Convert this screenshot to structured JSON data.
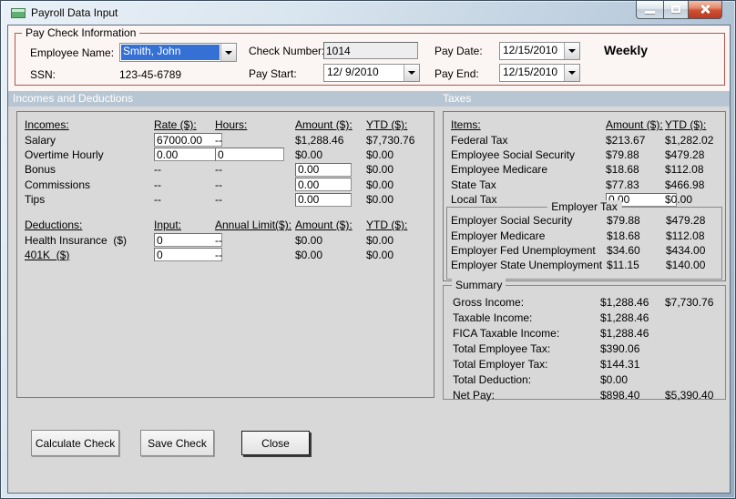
{
  "window": {
    "title": "Payroll Data Input"
  },
  "paycheck_info": {
    "group_label": "Pay Check Information",
    "employee_name_label": "Employee Name:",
    "employee_name_value": "Smith, John",
    "ssn_label": "SSN:",
    "ssn_value": "123-45-6789",
    "check_number_label": "Check Number:",
    "check_number_value": "1014",
    "pay_start_label": "Pay Start:",
    "pay_start_value": "12/ 9/2010",
    "pay_date_label": "Pay Date:",
    "pay_date_value": "12/15/2010",
    "pay_end_label": "Pay End:",
    "pay_end_value": "12/15/2010",
    "frequency": "Weekly"
  },
  "sections": {
    "incomes_header": "Incomes and Deductions",
    "taxes_header": "Taxes"
  },
  "incomes": {
    "headers": [
      "Incomes:",
      "Rate ($):",
      "Hours:",
      "Amount ($):",
      "YTD ($):"
    ],
    "rows": [
      [
        {
          "t": "text",
          "v": "Salary"
        },
        {
          "t": "input",
          "v": "67000.00",
          "w": 75,
          "n": "salary-rate-input"
        },
        {
          "t": "text",
          "v": "--"
        },
        {
          "t": "text",
          "v": "$1,288.46"
        },
        {
          "t": "text",
          "v": "$7,730.76"
        }
      ],
      [
        {
          "t": "text",
          "v": "Overtime Hourly"
        },
        {
          "t": "input",
          "v": "0.00",
          "w": 75,
          "n": "overtime-rate-input"
        },
        {
          "t": "input",
          "v": "0",
          "w": 76,
          "n": "overtime-hours-input"
        },
        {
          "t": "text",
          "v": "$0.00"
        },
        {
          "t": "text",
          "v": "$0.00"
        }
      ],
      [
        {
          "t": "text",
          "v": "Bonus"
        },
        {
          "t": "text",
          "v": "--"
        },
        {
          "t": "text",
          "v": "--"
        },
        {
          "t": "input",
          "v": "0.00",
          "w": 62,
          "n": "bonus-amount-input"
        },
        {
          "t": "text",
          "v": "$0.00"
        }
      ],
      [
        {
          "t": "text",
          "v": "Commissions"
        },
        {
          "t": "text",
          "v": "--"
        },
        {
          "t": "text",
          "v": "--"
        },
        {
          "t": "input",
          "v": "0.00",
          "w": 62,
          "n": "commissions-amount-input"
        },
        {
          "t": "text",
          "v": "$0.00"
        }
      ],
      [
        {
          "t": "text",
          "v": "Tips"
        },
        {
          "t": "text",
          "v": "--"
        },
        {
          "t": "text",
          "v": "--"
        },
        {
          "t": "input",
          "v": "0.00",
          "w": 62,
          "n": "tips-amount-input"
        },
        {
          "t": "text",
          "v": "$0.00"
        }
      ]
    ]
  },
  "deductions": {
    "headers": [
      "Deductions:",
      "Input:",
      "Annual Limit($):",
      "Amount ($):",
      "YTD ($):"
    ],
    "rows": [
      [
        {
          "t": "text",
          "v": "Health Insurance  ($)"
        },
        {
          "t": "input",
          "v": "0",
          "w": 75,
          "n": "health-insurance-input"
        },
        {
          "t": "text",
          "v": "--"
        },
        {
          "t": "text",
          "v": "$0.00"
        },
        {
          "t": "text",
          "v": "$0.00"
        }
      ],
      [
        {
          "t": "text",
          "v": "401K  ($)",
          "u": true
        },
        {
          "t": "input",
          "v": "0",
          "w": 75,
          "n": "401k-input"
        },
        {
          "t": "text",
          "v": "--"
        },
        {
          "t": "text",
          "v": "$0.00"
        },
        {
          "t": "text",
          "v": "$0.00"
        }
      ]
    ]
  },
  "taxes": {
    "headers": [
      "Items:",
      "Amount ($):",
      "YTD ($):"
    ],
    "rows": [
      [
        {
          "t": "text",
          "v": "Federal Tax"
        },
        {
          "t": "text",
          "v": "$213.67"
        },
        {
          "t": "text",
          "v": "$1,282.02"
        }
      ],
      [
        {
          "t": "text",
          "v": "Employee Social Security"
        },
        {
          "t": "text",
          "v": "$79.88"
        },
        {
          "t": "text",
          "v": "$479.28"
        }
      ],
      [
        {
          "t": "text",
          "v": "Employee Medicare"
        },
        {
          "t": "text",
          "v": "$18.68"
        },
        {
          "t": "text",
          "v": "$112.08"
        }
      ],
      [
        {
          "t": "text",
          "v": "State Tax"
        },
        {
          "t": "text",
          "v": "$77.83"
        },
        {
          "t": "text",
          "v": "$466.98"
        }
      ],
      [
        {
          "t": "text",
          "v": "Local Tax"
        },
        {
          "t": "input",
          "v": "0.00",
          "w": 78,
          "n": "local-tax-input"
        },
        {
          "t": "text",
          "v": "$0.00"
        }
      ]
    ],
    "employer_group_label": "Employer Tax",
    "employer_rows": [
      [
        {
          "t": "text",
          "v": "Employer Social Security"
        },
        {
          "t": "text",
          "v": "$79.88"
        },
        {
          "t": "text",
          "v": "$479.28"
        }
      ],
      [
        {
          "t": "text",
          "v": "Employer Medicare"
        },
        {
          "t": "text",
          "v": "$18.68"
        },
        {
          "t": "text",
          "v": "$112.08"
        }
      ],
      [
        {
          "t": "text",
          "v": "Employer Fed Unemployment"
        },
        {
          "t": "text",
          "v": "$34.60"
        },
        {
          "t": "text",
          "v": "$434.00"
        }
      ],
      [
        {
          "t": "text",
          "v": "Employer State Unemployment"
        },
        {
          "t": "text",
          "v": "$11.15"
        },
        {
          "t": "text",
          "v": "$140.00"
        }
      ]
    ]
  },
  "summary": {
    "group_label": "Summary",
    "rows": [
      [
        {
          "t": "text",
          "v": "Gross Income:"
        },
        {
          "t": "text",
          "v": "$1,288.46"
        },
        {
          "t": "text",
          "v": "$7,730.76"
        }
      ],
      [
        {
          "t": "text",
          "v": "Taxable Income:"
        },
        {
          "t": "text",
          "v": "$1,288.46"
        },
        {
          "t": "text",
          "v": ""
        }
      ],
      [
        {
          "t": "text",
          "v": "FICA Taxable Income:"
        },
        {
          "t": "text",
          "v": "$1,288.46"
        },
        {
          "t": "text",
          "v": ""
        }
      ],
      [
        {
          "t": "text",
          "v": "Total Employee Tax:"
        },
        {
          "t": "text",
          "v": "$390.06"
        },
        {
          "t": "text",
          "v": ""
        }
      ],
      [
        {
          "t": "text",
          "v": "Total Employer Tax:"
        },
        {
          "t": "text",
          "v": "$144.31"
        },
        {
          "t": "text",
          "v": ""
        }
      ],
      [
        {
          "t": "text",
          "v": "Total Deduction:"
        },
        {
          "t": "text",
          "v": "$0.00"
        },
        {
          "t": "text",
          "v": ""
        }
      ],
      [
        {
          "t": "text",
          "v": "Net Pay:"
        },
        {
          "t": "text",
          "v": "$898.40"
        },
        {
          "t": "text",
          "v": "$5,390.40"
        }
      ]
    ]
  },
  "buttons": {
    "calculate": "Calculate Check",
    "save": "Save Check",
    "close": "Close"
  }
}
